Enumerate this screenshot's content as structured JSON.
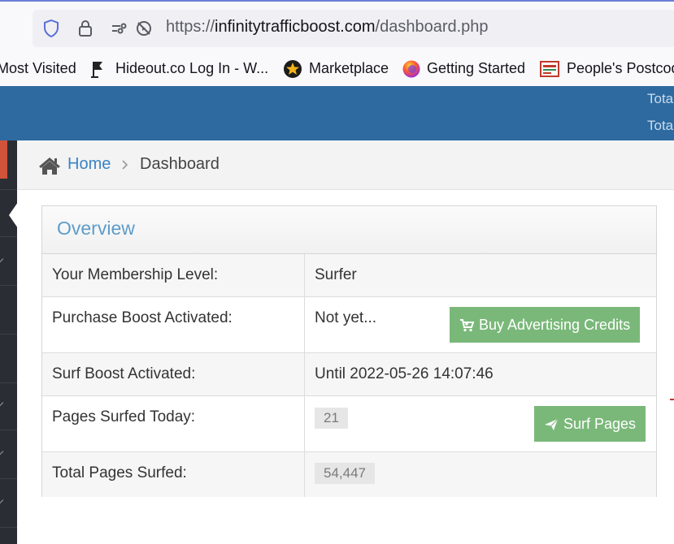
{
  "browser": {
    "url_prefix": "https://",
    "url_domain": "infinitytrafficboost.com",
    "url_path": "/dashboard.php",
    "bookmarks": [
      {
        "label": "Most Visited",
        "icon": "none"
      },
      {
        "label": "Hideout.co Log In - W...",
        "icon": "hideout-icon"
      },
      {
        "label": "Marketplace",
        "icon": "star-badge-icon"
      },
      {
        "label": "Getting Started",
        "icon": "firefox-icon"
      },
      {
        "label": "People's Postcod",
        "icon": "postcode-icon"
      }
    ]
  },
  "header": {
    "total_1": "Tota",
    "total_2": "Tota"
  },
  "breadcrumb": {
    "home": "Home",
    "separator": ">",
    "current": "Dashboard"
  },
  "overview": {
    "title": "Overview",
    "rows": [
      {
        "label": "Your Membership Level:",
        "value": "Surfer"
      },
      {
        "label": "Purchase Boost Activated:",
        "value": "Not yet...",
        "button": "Buy Advertising Credits"
      },
      {
        "label": "Surf Boost Activated:",
        "value": "Until 2022-05-26 14:07:46"
      },
      {
        "label": "Pages Surfed Today:",
        "value": "21",
        "button": "Surf Pages"
      },
      {
        "label": "Total Pages Surfed:",
        "value": "54,447"
      }
    ]
  },
  "colors": {
    "header_blue": "#2e6aa0",
    "button_green": "#7ab87a",
    "title_blue": "#5d9cc9",
    "link_blue": "#3a83c4",
    "sidebar_dark": "#2a2d33",
    "sidebar_accent": "#d0533a"
  }
}
